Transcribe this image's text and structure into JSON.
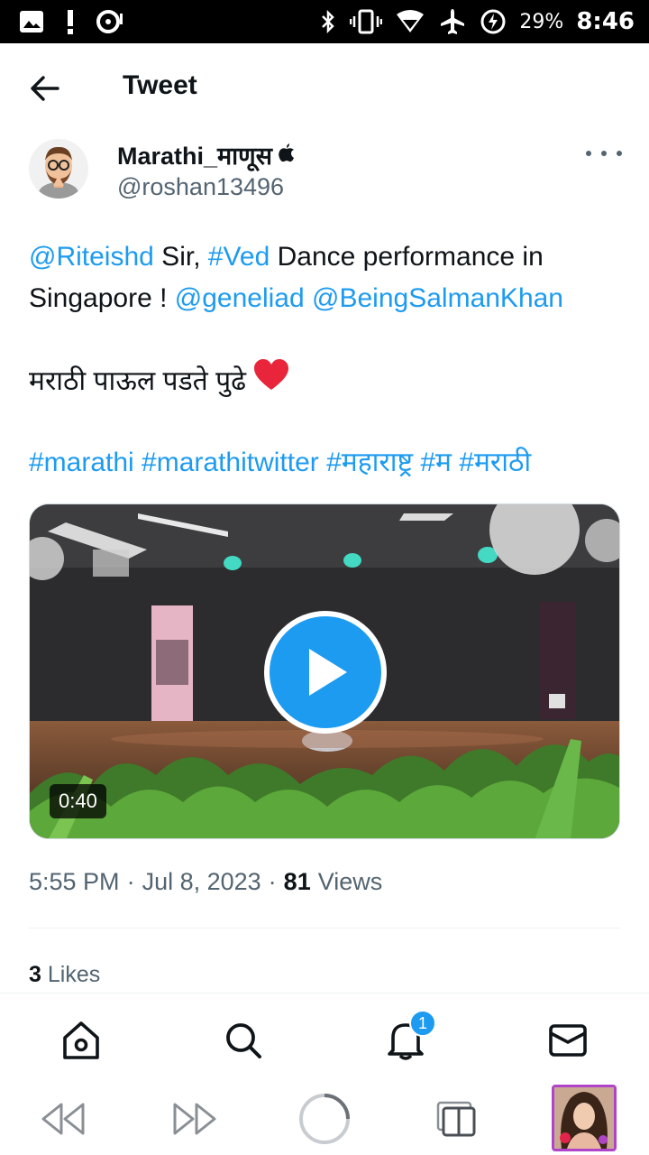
{
  "status_bar": {
    "battery": "29%",
    "time": "8:46"
  },
  "header": {
    "title": "Tweet"
  },
  "author": {
    "name": "Marathi_माणूस",
    "handle": "@roshan13496"
  },
  "tweet": {
    "line1_mention1": "@Riteishd",
    "line1_text1": " Sir, ",
    "line1_hashtag": "#Ved",
    "line1_text2": " Dance performance in Singapore ! ",
    "line1_mention2": "@geneliad",
    "line1_space": " ",
    "line1_mention3": "@BeingSalmanKhan",
    "line2_text": "मराठी पाऊल पडते पुढे",
    "hashtags": "#marathi #marathitwitter #महाराष्ट्र #म #मराठी"
  },
  "media": {
    "duration": "0:40"
  },
  "meta": {
    "time": "5:55 PM",
    "sep1": "·",
    "date": "Jul 8, 2023",
    "sep2": "·",
    "views_count": "81",
    "views_label": "Views"
  },
  "likes": {
    "count": "3",
    "label": "Likes"
  },
  "tabbar": {
    "notification_badge": "1"
  },
  "colors": {
    "accent": "#1d9bf0",
    "text": "#0f1419",
    "secondary": "#536471",
    "heart": "#f91880"
  }
}
